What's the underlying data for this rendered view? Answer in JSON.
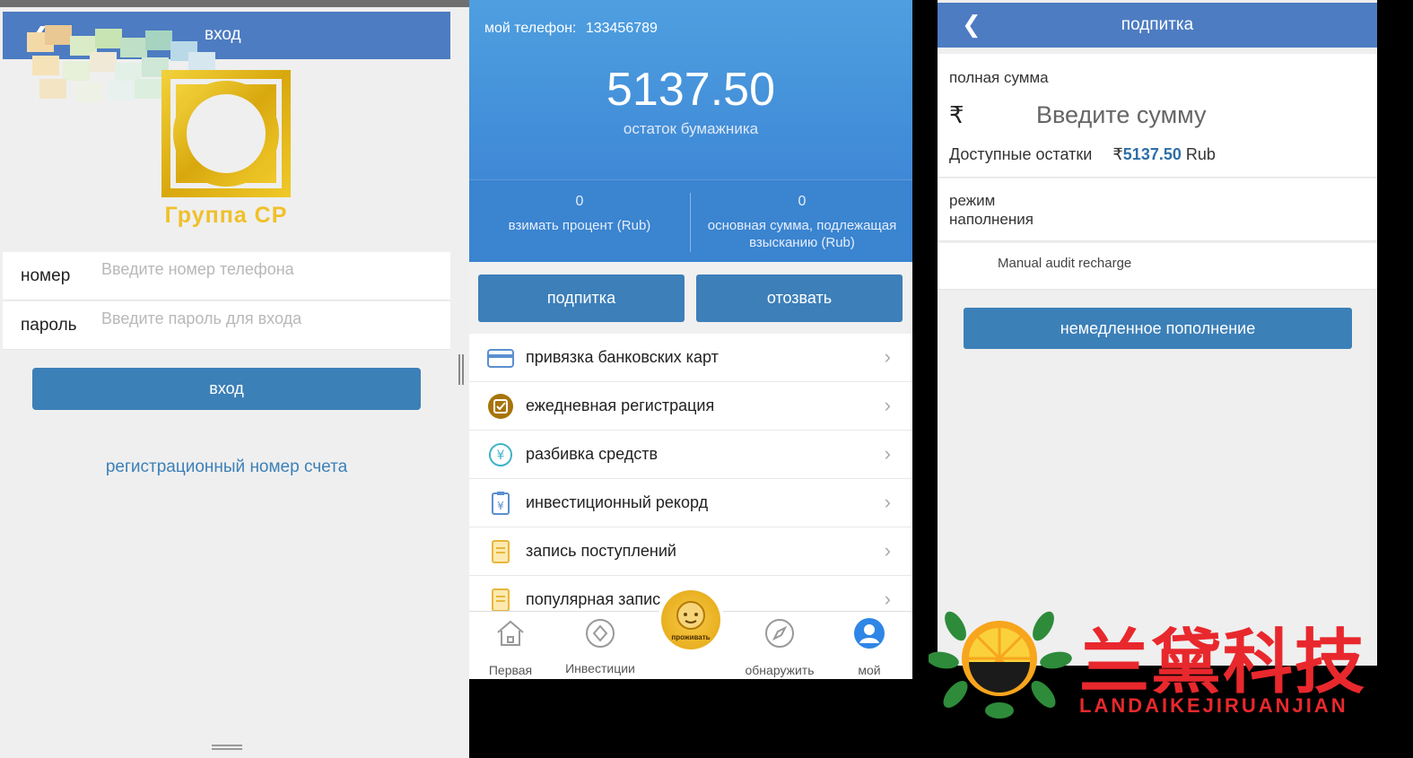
{
  "login": {
    "title": "вход",
    "logo_text": "Группа СР",
    "number_label": "номер",
    "number_placeholder": "Введите номер телефона",
    "password_label": "пароль",
    "password_placeholder": "Введите пароль для входа",
    "login_button": "вход",
    "register_link": "регистрационный номер счета"
  },
  "wallet": {
    "phone_label": "мой телефон:",
    "phone_value": "133456789",
    "balance": "5137.50",
    "balance_label": "остаток бумажника",
    "stats": [
      {
        "value": "0",
        "label": "взимать процент (Rub)"
      },
      {
        "value": "0",
        "label": "основная сумма, подлежащая взысканию (Rub)"
      }
    ],
    "buttons": {
      "recharge": "подпитка",
      "withdraw": "отозвать"
    },
    "menu": [
      {
        "label": "привязка банковских карт",
        "icon": "card-icon"
      },
      {
        "label": "ежедневная регистрация",
        "icon": "checkin-icon"
      },
      {
        "label": "разбивка средств",
        "icon": "yen-coin-icon"
      },
      {
        "label": "инвестиционный рекорд",
        "icon": "clipboard-yen-icon"
      },
      {
        "label": "запись поступлений",
        "icon": "document-icon"
      },
      {
        "label": "популярная запис",
        "icon": "document-icon"
      }
    ],
    "tabs": [
      {
        "label": "Первая",
        "icon": "home-icon"
      },
      {
        "label": "Инвестиции",
        "icon": "diamond-icon"
      },
      {
        "label": "проживать",
        "icon": "live-avatar-icon"
      },
      {
        "label": "обнаружить",
        "icon": "compass-icon"
      },
      {
        "label": "мой",
        "icon": "user-icon"
      }
    ]
  },
  "recharge": {
    "title": "подпитка",
    "amount_label": "полная сумма",
    "currency_symbol": "₹",
    "amount_placeholder": "Введите сумму",
    "available_label": "Доступные остатки",
    "available_symbol": "₹",
    "available_value": "5137.50",
    "available_unit": "Rub",
    "mode_label": "режим наполнения",
    "option": "Manual audit recharge",
    "submit_button": "немедленное пополнение"
  },
  "watermark": {
    "cn_text": "兰黛科技",
    "en_text": "LANDAIKEJIRUANJIAN"
  },
  "colors": {
    "header_blue": "#4d7cc2",
    "button_blue": "#3c80b8",
    "hero_blue": "#4e9fe0",
    "gold": "#e3a50f",
    "watermark_red": "#e8282d"
  }
}
